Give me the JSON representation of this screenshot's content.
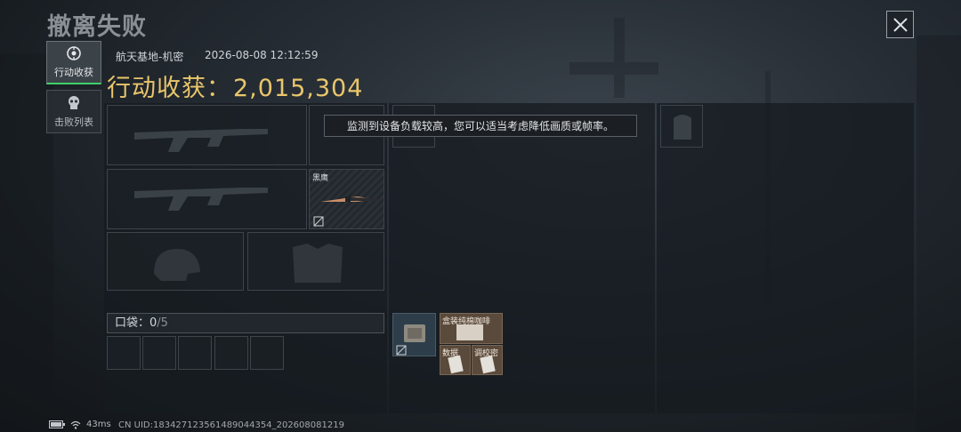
{
  "header": {
    "title": "撤离失败",
    "close_icon": "close-icon"
  },
  "sidebar": {
    "items": [
      {
        "label": "行动收获",
        "icon": "target-icon",
        "active": true
      },
      {
        "label": "击败列表",
        "icon": "skull-icon",
        "active": false
      }
    ]
  },
  "info": {
    "map_name": "航天基地-机密",
    "timestamp": "2026-08-08 12:12:59",
    "gain_label": "行动收获：",
    "gain_value": "2,015,304"
  },
  "toast": {
    "text": "监测到设备负载较高，您可以适当考虑降低画质或帧率。"
  },
  "loadout": {
    "melee_name": "黑鹰",
    "pocket_label": "口袋：",
    "pocket_count": "0",
    "pocket_max": "/5"
  },
  "items": {
    "tile_top_label": "盒装纯棉咖啡",
    "tile_left_label": "数据",
    "tile_right_label": "调校密"
  },
  "status": {
    "latency": "43ms",
    "uid": "CN UID:183427123561489044354_202608081219"
  },
  "colors": {
    "accent_gold": "#e9c66c",
    "active_green": "#3fd06a"
  }
}
